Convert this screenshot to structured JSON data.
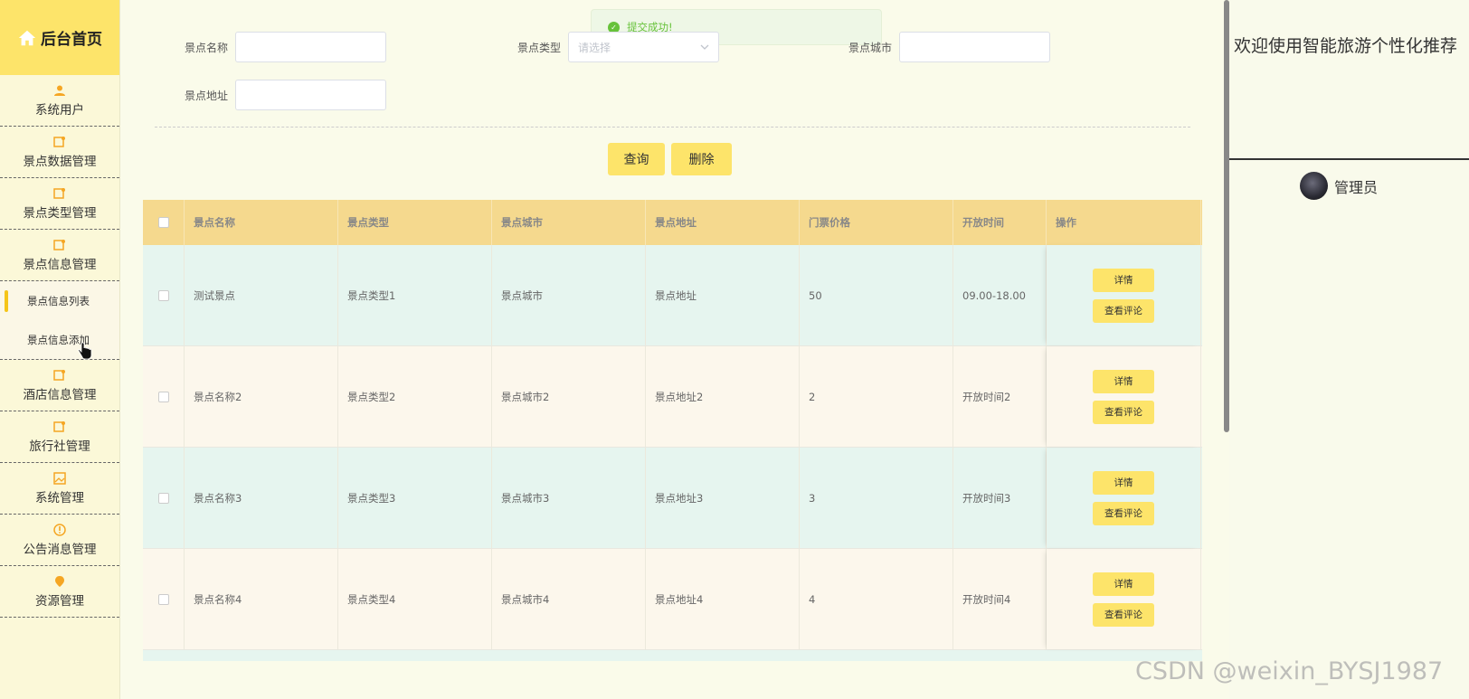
{
  "sidebar": {
    "brand": "后台首页",
    "items": [
      {
        "label": "系统用户"
      },
      {
        "label": "景点数据管理"
      },
      {
        "label": "景点类型管理"
      },
      {
        "label": "景点信息管理"
      },
      {
        "label": "酒店信息管理"
      },
      {
        "label": "旅行社管理"
      },
      {
        "label": "系统管理"
      },
      {
        "label": "公告消息管理"
      },
      {
        "label": "资源管理"
      }
    ],
    "submenu": [
      {
        "label": "景点信息列表"
      },
      {
        "label": "景点信息添加"
      }
    ]
  },
  "toast": {
    "message": "提交成功!"
  },
  "search": {
    "name_label": "景点名称",
    "type_label": "景点类型",
    "type_placeholder": "请选择",
    "city_label": "景点城市",
    "address_label": "景点地址",
    "query_button": "查询",
    "delete_button": "删除"
  },
  "table": {
    "headers": [
      "景点名称",
      "景点类型",
      "景点城市",
      "景点地址",
      "门票价格",
      "开放时间",
      "操作"
    ],
    "rows": [
      {
        "name": "测试景点",
        "type": "景点类型1",
        "city": "景点城市",
        "address": "景点地址",
        "price": "50",
        "time": "09.00-18.00"
      },
      {
        "name": "景点名称2",
        "type": "景点类型2",
        "city": "景点城市2",
        "address": "景点地址2",
        "price": "2",
        "time": "开放时间2"
      },
      {
        "name": "景点名称3",
        "type": "景点类型3",
        "city": "景点城市3",
        "address": "景点地址3",
        "price": "3",
        "time": "开放时间3"
      },
      {
        "name": "景点名称4",
        "type": "景点类型4",
        "city": "景点城市4",
        "address": "景点地址4",
        "price": "4",
        "time": "开放时间4"
      }
    ],
    "detail_button": "详情",
    "comment_button": "查看评论"
  },
  "right_panel": {
    "welcome": "欢迎使用智能旅游个性化推荐",
    "user_name": "管理员"
  },
  "watermark": "CSDN @weixin_BYSJ1987",
  "colors": {
    "accent": "#fde46a",
    "header": "#f5d98e",
    "success": "#67c23a"
  }
}
